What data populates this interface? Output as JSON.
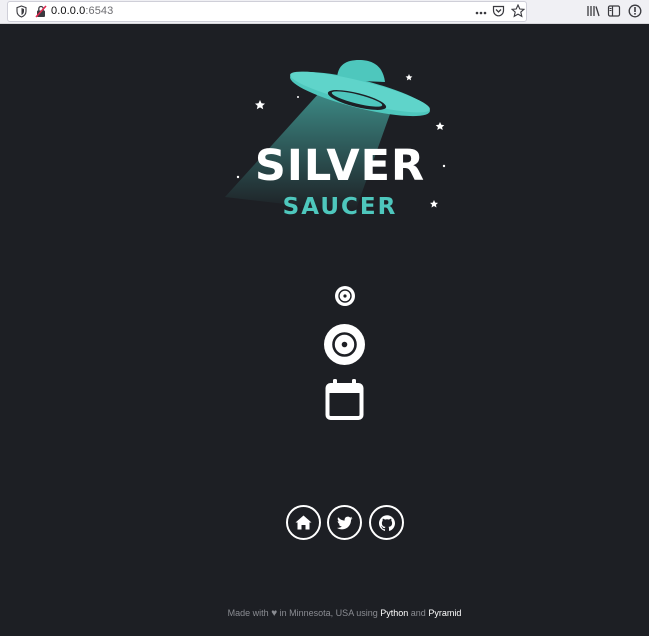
{
  "browser": {
    "url_host": "0.0.0.0",
    "url_port": ":6543"
  },
  "logo": {
    "line1": "SILVER",
    "line2": "SAUCER"
  },
  "controls": {
    "small_disc_icon": "disc-icon",
    "big_disc_icon": "disc-icon",
    "calendar_icon": "calendar-icon"
  },
  "social": {
    "home_icon": "home-icon",
    "twitter_icon": "twitter-icon",
    "github_icon": "github-icon"
  },
  "footer": {
    "made_with": "Made with",
    "heart": "♥",
    "in_location": "in Minnesota, USA using",
    "python": "Python",
    "and": "and",
    "pyramid": "Pyramid"
  },
  "colors": {
    "background": "#1d1f24",
    "accent": "#4ec7bd",
    "text_muted": "#8a8c92"
  }
}
